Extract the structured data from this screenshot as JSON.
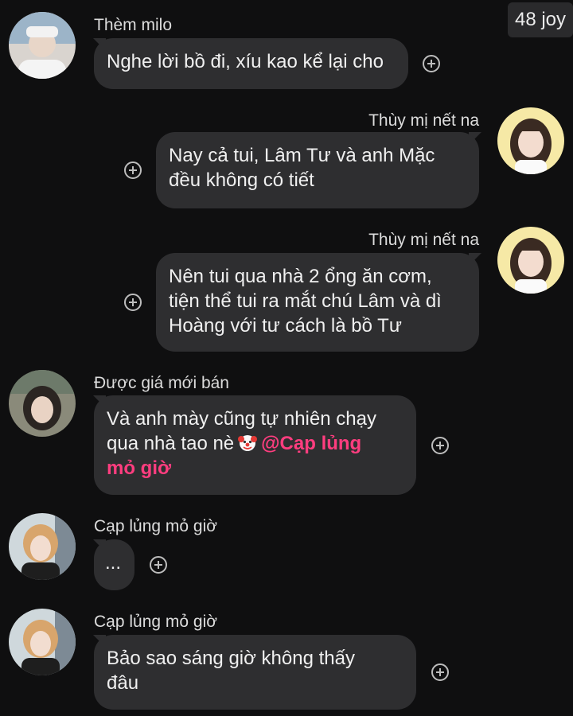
{
  "badge": {
    "text": "48 joy"
  },
  "messages": [
    {
      "sender": "Thèm milo",
      "side": "left",
      "lines": [
        "Nghe lời bồ đi, xíu kao kể lại cho"
      ]
    },
    {
      "sender": "Thùy mị nết na",
      "side": "right",
      "lines": [
        "Nay cả tui, Lâm Tư và anh Mặc",
        "đều không có tiết"
      ]
    },
    {
      "sender": "Thùy mị nết na",
      "side": "right",
      "lines": [
        "Nên tui qua nhà 2 ổng ăn cơm,",
        "tiện thể tui ra mắt chú Lâm và dì",
        "Hoàng với tư cách là bồ Tư"
      ]
    },
    {
      "sender": "Được giá mới bán",
      "side": "left",
      "lines": [
        "Và anh mày cũng tự nhiên chạy"
      ],
      "line2_prefix": "qua nhà tao nè",
      "emoji": "clown-emoji",
      "mention_a": "@Cạp lủng",
      "mention_b": "mỏ giờ"
    },
    {
      "sender": "Cạp lủng mỏ giờ",
      "side": "left",
      "lines": [
        "..."
      ]
    },
    {
      "sender": "Cạp lủng mỏ giờ",
      "side": "left",
      "lines": [
        "Bảo sao sáng giờ không thấy",
        "đâu"
      ]
    }
  ],
  "colors": {
    "background": "#0f0f10",
    "bubble": "#2e2e30",
    "mention": "#ff3d7f"
  },
  "icons": [
    "add-reaction-icon",
    "clown-emoji"
  ]
}
